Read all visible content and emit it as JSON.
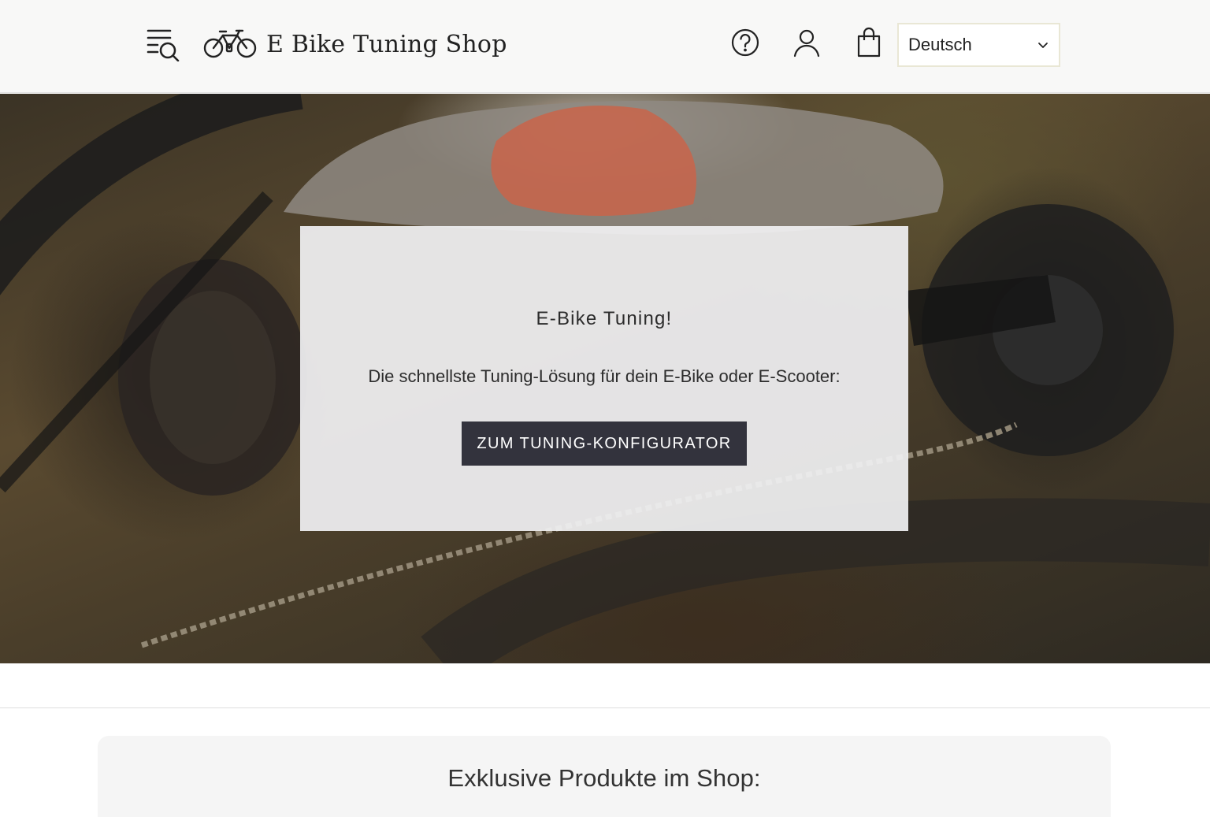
{
  "header": {
    "logo_text": "E Bike Tuning Shop",
    "language": "Deutsch",
    "icons": [
      "menu-search-icon",
      "bicycle-logo-icon",
      "help-icon",
      "account-icon",
      "shopping-bag-icon",
      "chevron-down-icon"
    ]
  },
  "hero": {
    "title": "E-Bike Tuning!",
    "subtitle": "Die schnellste Tuning-Lösung für dein E-Bike oder E-Scooter:",
    "button_label": "ZUM TUNING-KONFIGURATOR"
  },
  "products": {
    "title": "Exklusive Produkte im Shop:"
  },
  "colors": {
    "header_bg": "#f8f8f7",
    "button_bg": "#33333d",
    "card_bg": "#f0f0f2"
  }
}
